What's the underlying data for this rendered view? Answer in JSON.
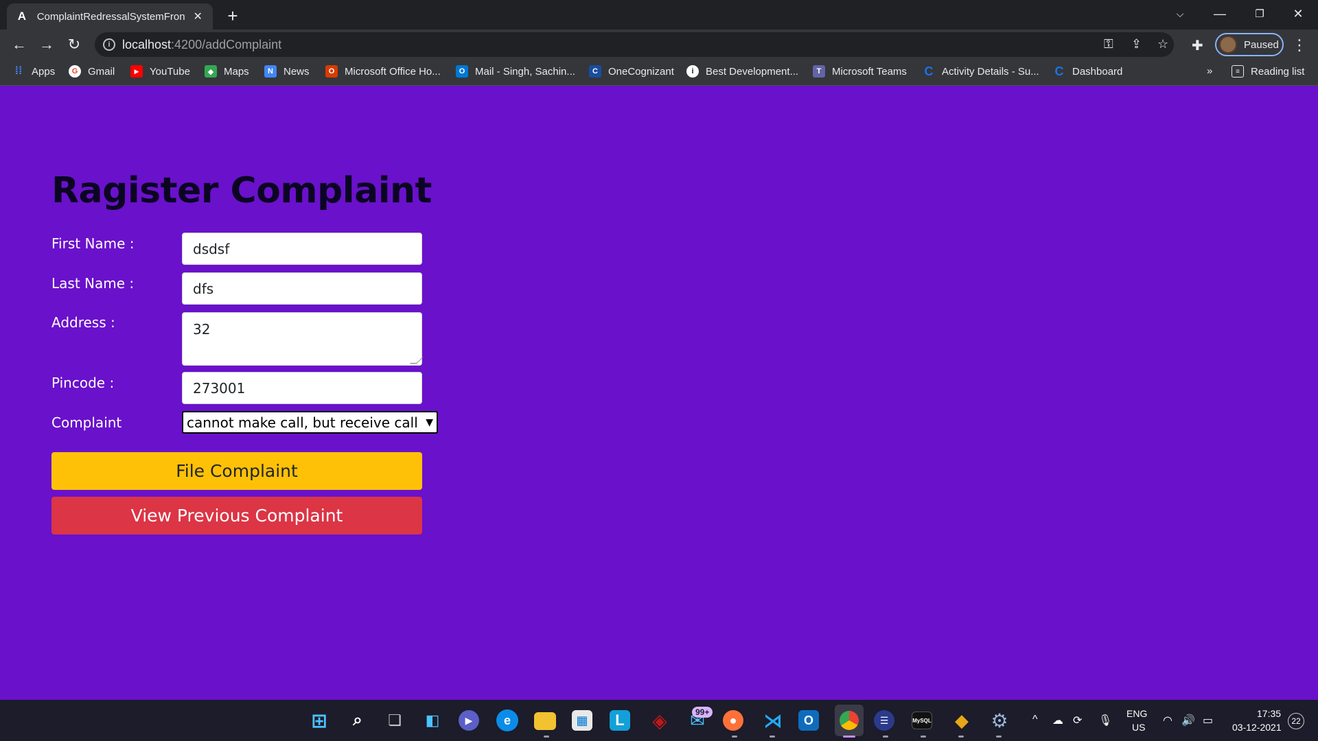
{
  "browser": {
    "tab_title": "ComplaintRedressalSystemFronte",
    "tab_favicon": "A",
    "url_host": "localhost",
    "url_path": ":4200/addComplaint",
    "profile_label": "Paused",
    "bookmarks": [
      {
        "label": "Apps",
        "icon": "apps-grid-icon",
        "color": "#4285f4"
      },
      {
        "label": "Gmail",
        "icon": "google-icon",
        "color": "#ea4335"
      },
      {
        "label": "YouTube",
        "icon": "youtube-icon",
        "color": "#ff0000"
      },
      {
        "label": "Maps",
        "icon": "maps-icon",
        "color": "#34a853"
      },
      {
        "label": "News",
        "icon": "news-icon",
        "color": "#4285f4"
      },
      {
        "label": "Microsoft Office Ho...",
        "icon": "office-icon",
        "color": "#d83b01"
      },
      {
        "label": "Mail - Singh, Sachin...",
        "icon": "outlook-icon",
        "color": "#0078d4"
      },
      {
        "label": "OneCognizant",
        "icon": "cognizant-icon",
        "color": "#1a4ca0"
      },
      {
        "label": "Best Development...",
        "icon": "info-icon",
        "color": "#ffffff"
      },
      {
        "label": "Microsoft Teams",
        "icon": "teams-icon",
        "color": "#6264a7"
      },
      {
        "label": "Activity Details - Su...",
        "icon": "c-logo-icon",
        "color": "#1a73e8"
      },
      {
        "label": "Dashboard",
        "icon": "c-logo-icon",
        "color": "#1a73e8"
      }
    ],
    "more_bookmarks": "»",
    "reading_list": "Reading list"
  },
  "form": {
    "title": "Ragister Complaint",
    "first_name_label": "First Name :",
    "first_name_value": "dsdsf",
    "last_name_label": "Last Name :",
    "last_name_value": "dfs",
    "address_label": "Address :",
    "address_value": "32",
    "pincode_label": "Pincode :",
    "pincode_value": "273001",
    "complaint_label": "Complaint",
    "complaint_selected": "cannot make call, but receive call",
    "file_button": "File Complaint",
    "view_button": "View Previous Complaint"
  },
  "colors": {
    "page_background": "#6a11cb",
    "file_button": "#ffc107",
    "view_button": "#dc3545"
  },
  "taskbar": {
    "mail_badge": "99+",
    "language": "ENG",
    "region": "US",
    "time": "17:35",
    "date": "03-12-2021",
    "notification_count": "22"
  }
}
